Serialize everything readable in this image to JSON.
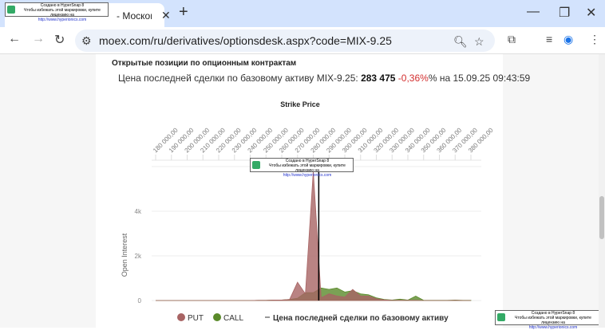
{
  "browser": {
    "tab_title": "- Московская биржа",
    "url": "moex.com/ru/derivatives/optionsdesk.aspx?code=MIX-9.25"
  },
  "watermark": {
    "line1": "Создано в HyperSnap 8",
    "line2": "Чтобы избежать этой маркировки, купите лицензию на",
    "link": "http://www.hyperionics.com"
  },
  "page": {
    "heading": "Открытые позиции по опционным контрактам",
    "price_prefix": "Цена последней сделки по базовому активу MIX-9.25:",
    "price_value": "283 475",
    "price_change": "-0,36%",
    "price_suffix": "% на 15.09.25 09:43:59"
  },
  "chart_data": {
    "type": "area",
    "title": "Strike Price",
    "ylabel": "Open Interest",
    "x_tick_labels": [
      "180 000,00",
      "190 000,00",
      "200 000,00",
      "210 000,00",
      "220 000,00",
      "230 000,00",
      "240 000,00",
      "250 000,00",
      "260 000,00",
      "270 000,00",
      "280 000,00",
      "290 000,00",
      "300 000,00",
      "310 000,00",
      "320 000,00",
      "330 000,00",
      "340 000,00",
      "350 000,00",
      "360 000,00",
      "370 000,00",
      "380 000,00"
    ],
    "y_tick_labels": [
      "0",
      "2k",
      "4k"
    ],
    "ylim": [
      0,
      6000
    ],
    "xlim": [
      180000,
      380000
    ],
    "x": [
      180000,
      185000,
      190000,
      195000,
      200000,
      205000,
      210000,
      215000,
      220000,
      225000,
      230000,
      235000,
      240000,
      245000,
      250000,
      255000,
      260000,
      265000,
      270000,
      275000,
      280000,
      285000,
      290000,
      295000,
      300000,
      305000,
      310000,
      315000,
      320000,
      325000,
      330000,
      335000,
      340000,
      345000,
      350000,
      355000,
      360000,
      365000,
      370000,
      375000,
      380000
    ],
    "series": [
      {
        "name": "PUT",
        "color": "#a86464",
        "values": [
          0,
          0,
          0,
          0,
          0,
          0,
          0,
          0,
          0,
          0,
          0,
          0,
          0,
          10,
          10,
          20,
          20,
          50,
          820,
          300,
          5800,
          120,
          300,
          200,
          150,
          500,
          200,
          200,
          80,
          30,
          10,
          10,
          10,
          10,
          0,
          0,
          0,
          0,
          10,
          0,
          0
        ]
      },
      {
        "name": "CALL",
        "color": "#5a8a2a",
        "values": [
          0,
          0,
          0,
          0,
          0,
          0,
          0,
          0,
          0,
          0,
          0,
          0,
          0,
          10,
          10,
          20,
          20,
          50,
          100,
          350,
          350,
          560,
          500,
          560,
          380,
          440,
          300,
          260,
          120,
          50,
          20,
          60,
          20,
          200,
          10,
          10,
          10,
          10,
          20,
          10,
          10
        ]
      }
    ],
    "reference_line": {
      "label": "Цена последней сделки по базовому активу",
      "value": 283475
    }
  }
}
